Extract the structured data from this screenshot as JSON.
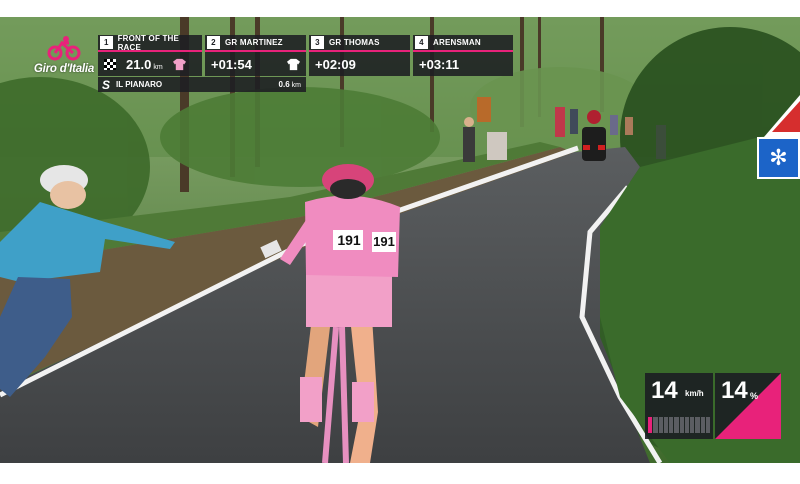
{
  "broadcast": {
    "logo_text": "Giro d'Italia",
    "cards": [
      {
        "position": "1",
        "title": "FRONT OF THE RACE",
        "value": "21.0",
        "unit": "km"
      },
      {
        "position": "2",
        "title": "GR MARTINEZ",
        "value": "+01:54"
      },
      {
        "position": "3",
        "title": "GR THOMAS",
        "value": "+02:09"
      },
      {
        "position": "4",
        "title": "ARENSMAN",
        "value": "+03:11"
      }
    ],
    "climb": {
      "icon": "S",
      "name": "IL PIANARO",
      "distance": "0.6",
      "unit": "km"
    }
  },
  "telemetry": {
    "speed_value": "14",
    "speed_unit": "km/h",
    "grade_value": "14",
    "grade_unit": "%",
    "effort_segments_total": 12,
    "effort_segments_active": 1
  },
  "scene": {
    "rider_number": "191",
    "rider_jersey_color": "#f2a0c8"
  },
  "colors": {
    "accent": "#e8227a",
    "overlay_bg": "#1c1e22",
    "road": "#4a4c4f",
    "forest": "#2f5a24"
  },
  "icons": {
    "logo": "cyclist-logo-icon",
    "front": "checkered-flag-icon",
    "leader": "pink-jersey-icon",
    "group": "white-jersey-icon"
  }
}
